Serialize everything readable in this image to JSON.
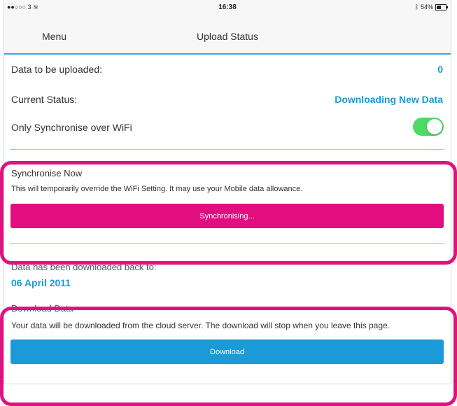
{
  "status_bar": {
    "carrier": "●●○○○ 3",
    "time": "16:38",
    "battery_percent": "54%"
  },
  "navbar": {
    "menu_label": "Menu",
    "title": "Upload Status"
  },
  "rows": {
    "data_to_upload_label": "Data to be uploaded:",
    "data_to_upload_value": "0",
    "current_status_label": "Current Status:",
    "current_status_value": "Downloading New Data",
    "wifi_only_label": "Only Synchronise over WiFi",
    "wifi_only_enabled": true
  },
  "sync": {
    "title": "Synchronise Now",
    "description": "This will temporarily override the WiFi Setting.  It may use your Mobile data allowance.",
    "button_label": "Synchronising..."
  },
  "download_info": {
    "label": "Data has been downloaded back to:",
    "date": "06 April 2011"
  },
  "download": {
    "title": "Download Data",
    "description": "Your data will be downloaded from the cloud server. The download will stop when you leave this page.",
    "button_label": "Download"
  },
  "colors": {
    "accent_blue": "#1a9ad6",
    "highlight_magenta": "#e0127f",
    "sync_button": "#e20e80",
    "toggle_on": "#4cd964"
  }
}
